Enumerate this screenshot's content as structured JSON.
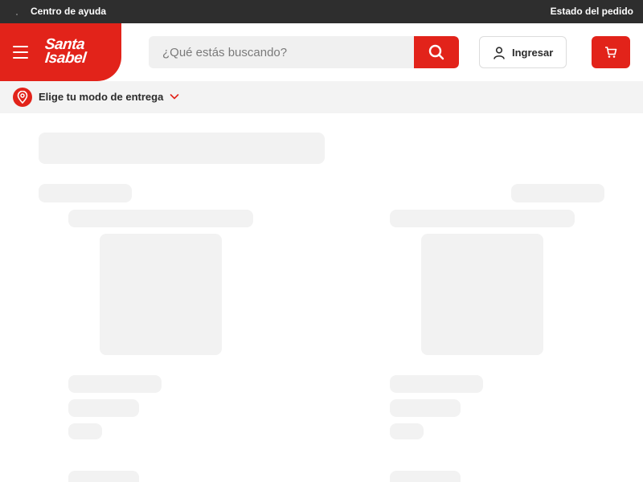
{
  "topbar": {
    "help_label": "Centro de ayuda",
    "order_status_label": "Estado del pedido"
  },
  "header": {
    "logo_line1": "Santa",
    "logo_line2": "Isabel",
    "search_placeholder": "¿Qué estás buscando?",
    "login_label": "Ingresar",
    "menu_icon": "hamburger-menu-icon",
    "search_icon": "search-icon",
    "user_icon": "user-icon",
    "cart_icon": "cart-icon"
  },
  "delivery": {
    "label": "Elige tu modo de entrega",
    "pin_icon": "location-pin-icon",
    "chevron_icon": "chevron-down-icon"
  },
  "colors": {
    "brand_red": "#e2231a",
    "topbar_bg": "#2e2e2e",
    "skeleton": "#f2f2f2"
  }
}
